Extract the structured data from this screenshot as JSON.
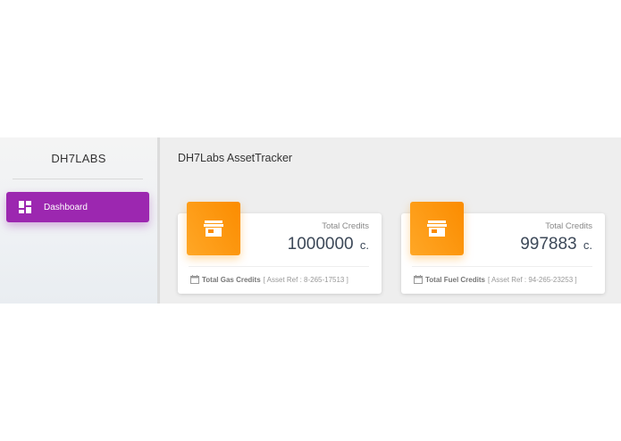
{
  "sidebar": {
    "brand": "DH7LABS",
    "nav_items": [
      {
        "label": "Dashboard",
        "icon": "dashboard-icon",
        "active": true
      }
    ]
  },
  "header": {
    "title": "DH7Labs AssetTracker"
  },
  "cards": [
    {
      "icon": "store-icon",
      "category": "Total Credits",
      "value": "1000000",
      "unit": "c.",
      "footer_label": "Total Gas Credits",
      "footer_ref": "[ Asset Ref : 8-265-17513 ]"
    },
    {
      "icon": "store-icon",
      "category": "Total Credits",
      "value": "997883",
      "unit": "c.",
      "footer_label": "Total Fuel Credits",
      "footer_ref": "[ Asset Ref : 94-265-23253 ]"
    }
  ],
  "colors": {
    "accent_purple": "#9c27b0",
    "accent_orange": "#fb8c00",
    "background": "#eeeeee"
  }
}
